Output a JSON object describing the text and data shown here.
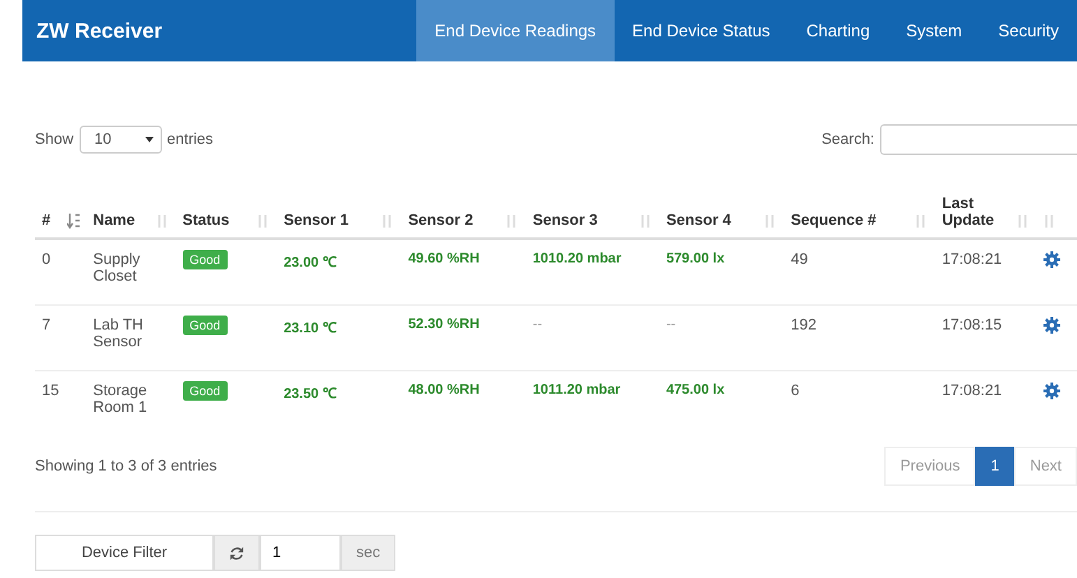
{
  "navbar": {
    "brand": "ZW Receiver",
    "items": [
      {
        "label": "End Device Readings",
        "selected": true
      },
      {
        "label": "End Device Status",
        "selected": false
      },
      {
        "label": "Charting",
        "selected": false
      },
      {
        "label": "System",
        "selected": false
      },
      {
        "label": "Security",
        "selected": false
      }
    ]
  },
  "length_control": {
    "before": "Show",
    "value": "10",
    "after": "entries"
  },
  "search": {
    "label": "Search:"
  },
  "table": {
    "columns": [
      {
        "label": "#",
        "sorted": true
      },
      {
        "label": "Name",
        "sorted": false
      },
      {
        "label": "Status",
        "sorted": false
      },
      {
        "label": "Sensor 1",
        "sorted": false
      },
      {
        "label": "Sensor 2",
        "sorted": false
      },
      {
        "label": "Sensor 3",
        "sorted": false
      },
      {
        "label": "Sensor 4",
        "sorted": false
      },
      {
        "label": "Sequence #",
        "sorted": false
      },
      {
        "label": "Last Update",
        "sorted": false
      },
      {
        "sorted": false
      }
    ],
    "rows": [
      {
        "id": "0",
        "name": "Supply Closet",
        "status": "Good",
        "sensors": [
          {
            "text": "23.00 ℃",
            "valid": true
          },
          {
            "text": "49.60 %RH",
            "valid": true
          },
          {
            "text": "1010.20 mbar",
            "valid": true
          },
          {
            "text": "579.00 lx",
            "valid": true
          }
        ],
        "sequence": "49",
        "last_update": "17:08:21"
      },
      {
        "id": "7",
        "name": "Lab TH Sensor",
        "status": "Good",
        "sensors": [
          {
            "text": "23.10 ℃",
            "valid": true
          },
          {
            "text": "52.30 %RH",
            "valid": true
          },
          {
            "text": "--",
            "valid": false
          },
          {
            "text": "--",
            "valid": false
          }
        ],
        "sequence": "192",
        "last_update": "17:08:15"
      },
      {
        "id": "15",
        "name": "Storage Room 1",
        "status": "Good",
        "sensors": [
          {
            "text": "23.50 ℃",
            "valid": true
          },
          {
            "text": "48.00 %RH",
            "valid": true
          },
          {
            "text": "1011.20 mbar",
            "valid": true
          },
          {
            "text": "475.00 lx",
            "valid": true
          }
        ],
        "sequence": "6",
        "last_update": "17:08:21"
      }
    ]
  },
  "info": "Showing 1 to 3 of 3 entries",
  "pagination": [
    {
      "label": "Previous",
      "selected": false
    },
    {
      "label": "1",
      "selected": true
    },
    {
      "label": "Next",
      "selected": false
    }
  ],
  "refresh": {
    "filter_button": "Device Filter",
    "interval": "1",
    "unit": "sec"
  }
}
